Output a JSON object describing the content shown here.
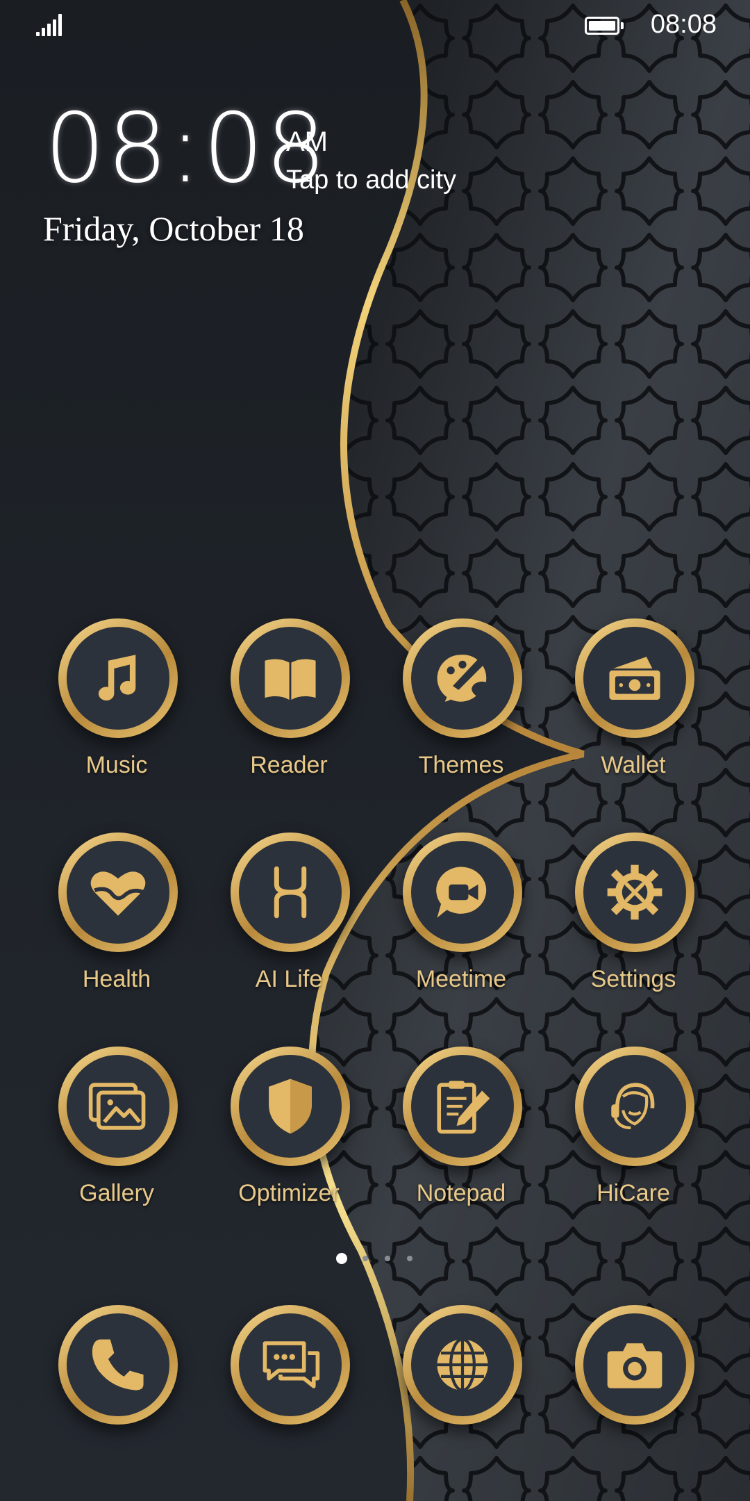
{
  "status_bar": {
    "time": "08:08",
    "signal_icon": "signal-icon",
    "battery_icon": "battery-icon"
  },
  "clock_widget": {
    "time": "08:08",
    "ampm": "AM",
    "city_prompt": "Tap to add city",
    "date": "Friday, October 18"
  },
  "apps": [
    {
      "label": "Music",
      "icon": "music-note-icon"
    },
    {
      "label": "Reader",
      "icon": "book-icon"
    },
    {
      "label": "Themes",
      "icon": "palette-brush-icon"
    },
    {
      "label": "Wallet",
      "icon": "wallet-cash-icon"
    },
    {
      "label": "Health",
      "icon": "heart-icon"
    },
    {
      "label": "AI Life",
      "icon": "ai-life-icon"
    },
    {
      "label": "Meetime",
      "icon": "video-chat-icon"
    },
    {
      "label": "Settings",
      "icon": "gear-tools-icon"
    },
    {
      "label": "Gallery",
      "icon": "gallery-icon"
    },
    {
      "label": "Optimizer",
      "icon": "shield-icon"
    },
    {
      "label": "Notepad",
      "icon": "notepad-pencil-icon"
    },
    {
      "label": "HiCare",
      "icon": "headset-person-icon"
    }
  ],
  "dock": [
    {
      "icon": "phone-icon"
    },
    {
      "icon": "messages-icon"
    },
    {
      "icon": "globe-icon"
    },
    {
      "icon": "camera-icon"
    }
  ],
  "page_indicator": {
    "pages": 4,
    "active": 1
  },
  "colors": {
    "gold": "#e9c98a",
    "ring_dark": "#2b323b",
    "background": "#1c2025"
  }
}
